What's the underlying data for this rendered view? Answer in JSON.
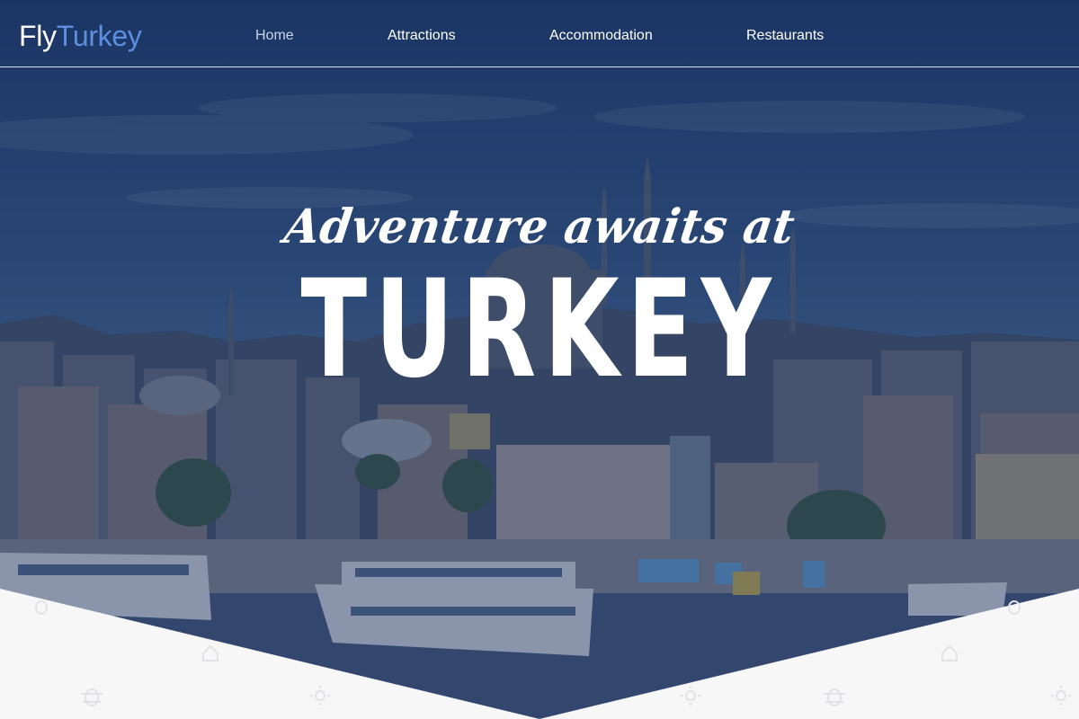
{
  "brand": {
    "name_part1": "Fly",
    "name_part2": "Turkey",
    "primary_color": "#ffffff",
    "accent_color": "#5d8fde"
  },
  "nav": {
    "items": [
      {
        "label": "Home",
        "active": true
      },
      {
        "label": "Attractions",
        "active": false
      },
      {
        "label": "Accommodation",
        "active": false
      },
      {
        "label": "Restaurants",
        "active": false
      }
    ]
  },
  "hero": {
    "tagline": "Adventure awaits at",
    "headline": "TURKEY",
    "overlay_color": "#183062"
  },
  "colors": {
    "background_bottom": "#f7f7f8",
    "pattern_icon": "#e4e4e8"
  },
  "icons": [
    "bug-icon",
    "sun-icon",
    "house-icon"
  ]
}
